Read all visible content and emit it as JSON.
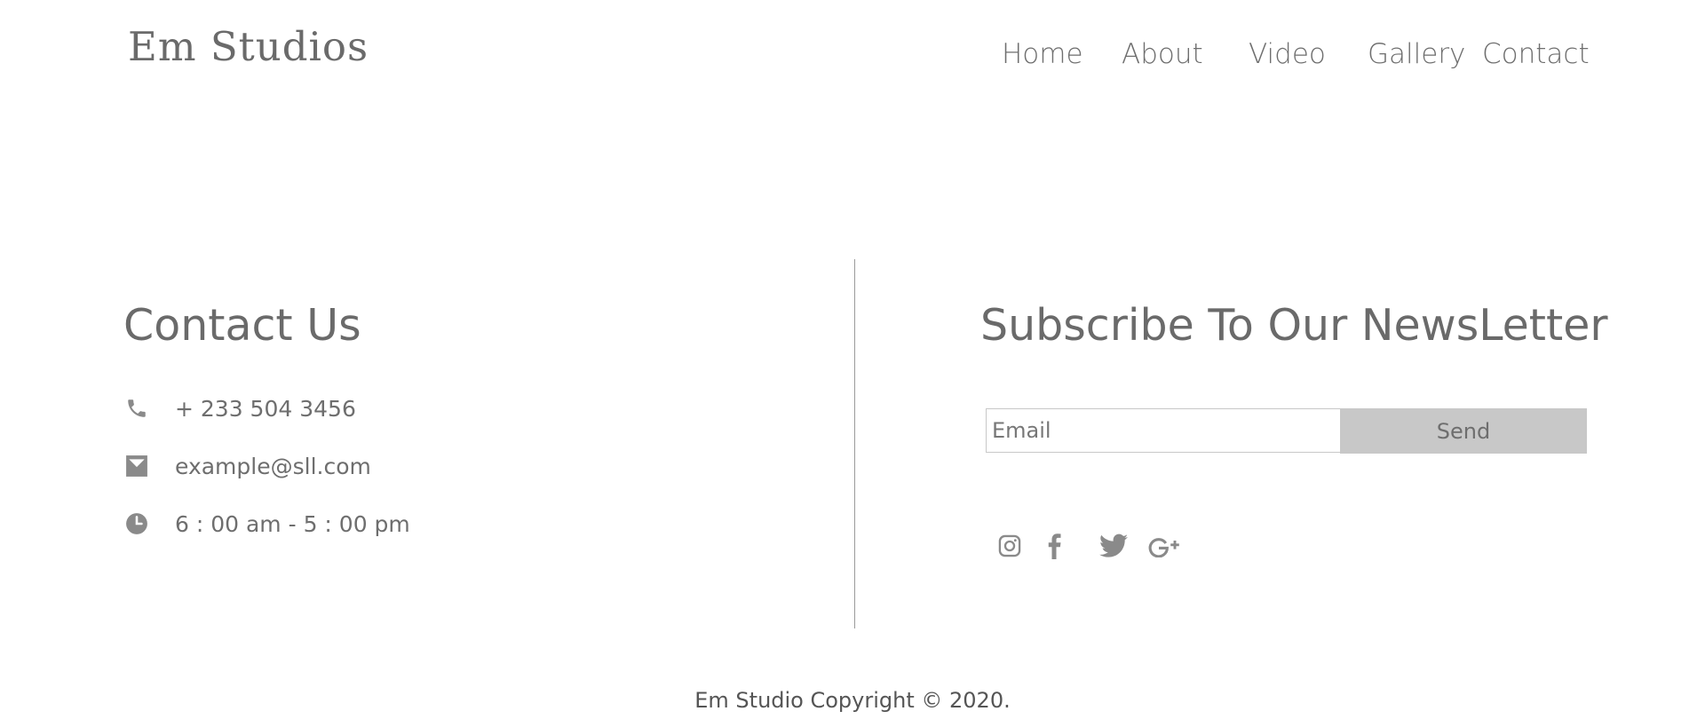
{
  "brand": {
    "logo_text": "Em Studios"
  },
  "nav": {
    "items": [
      {
        "label": "Home"
      },
      {
        "label": "About"
      },
      {
        "label": "Video"
      },
      {
        "label": "Gallery"
      },
      {
        "label": "Contact"
      }
    ]
  },
  "contact": {
    "title": "Contact Us",
    "phone": {
      "icon": "phone-icon",
      "text": "+ 233 504 3456"
    },
    "email": {
      "icon": "mail-icon",
      "text": "example@sll.com"
    },
    "hours": {
      "icon": "clock-icon",
      "text": "6 : 00 am - 5 : 00 pm"
    }
  },
  "newsletter": {
    "title": "Subscribe To Our NewsLetter",
    "email_placeholder": "Email",
    "email_value": "",
    "send_label": "Send",
    "social": [
      {
        "icon": "instagram-icon"
      },
      {
        "icon": "facebook-icon"
      },
      {
        "icon": "twitter-icon"
      },
      {
        "icon": "google-plus-icon"
      }
    ]
  },
  "footer": {
    "copyright": "Em Studio Copyright © 2020."
  },
  "colors": {
    "text": "#6e6e6e",
    "icon": "#8a8a8a",
    "button_bg": "#c8c8c8",
    "divider": "#9a9a9a",
    "background": "#ffffff"
  }
}
